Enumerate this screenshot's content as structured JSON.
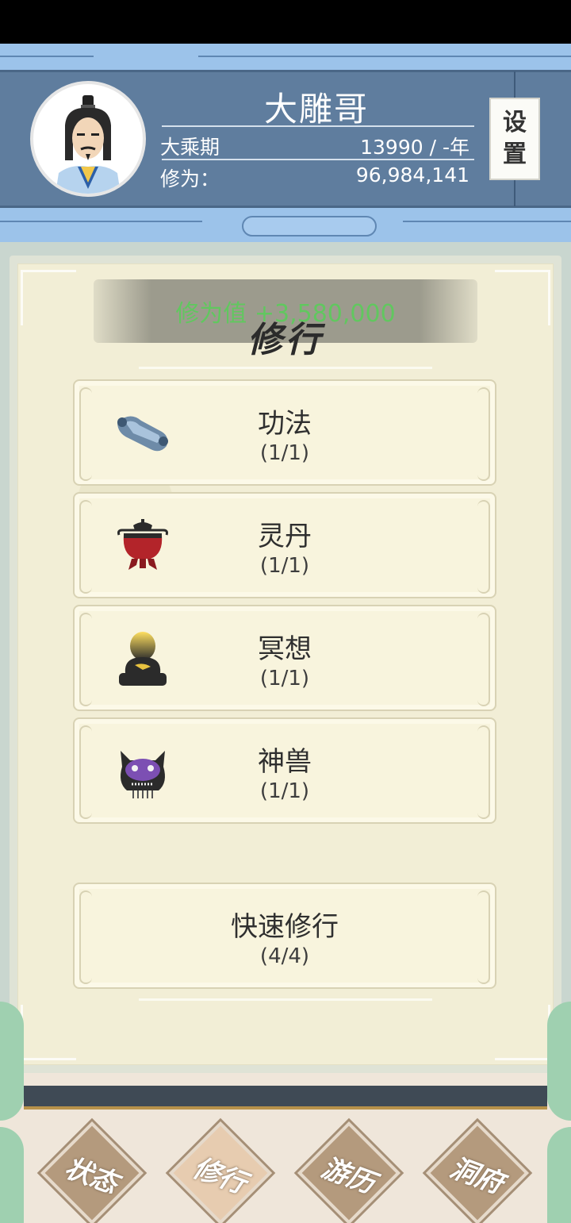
{
  "header": {
    "player_name": "大雕哥",
    "realm": "大乘期",
    "age": "13990 / -年",
    "cultivation_label": "修为：",
    "cultivation_value": "96,984,141",
    "settings_label_1": "设",
    "settings_label_2": "置"
  },
  "panel": {
    "title": "修行",
    "gain_notice": "修为值 +3,580,000"
  },
  "cards": [
    {
      "label": "功法",
      "count": "(1/1)",
      "icon": "scroll-icon"
    },
    {
      "label": "灵丹",
      "count": "(1/1)",
      "icon": "cauldron-icon"
    },
    {
      "label": "冥想",
      "count": "(1/1)",
      "icon": "meditation-icon"
    },
    {
      "label": "神兽",
      "count": "(1/1)",
      "icon": "beast-icon"
    }
  ],
  "quick_cultivation": {
    "label": "快速修行",
    "count": "(4/4)"
  },
  "nav": [
    {
      "label": "状态"
    },
    {
      "label": "修行"
    },
    {
      "label": "游历"
    },
    {
      "label": "洞府"
    }
  ],
  "colors": {
    "header_panel": "#5f7d9e",
    "header_band": "#9cc3ea",
    "parchment": "#f2eed6",
    "gain_text": "#5bcc5b",
    "card_bg": "#f8f4dd"
  }
}
